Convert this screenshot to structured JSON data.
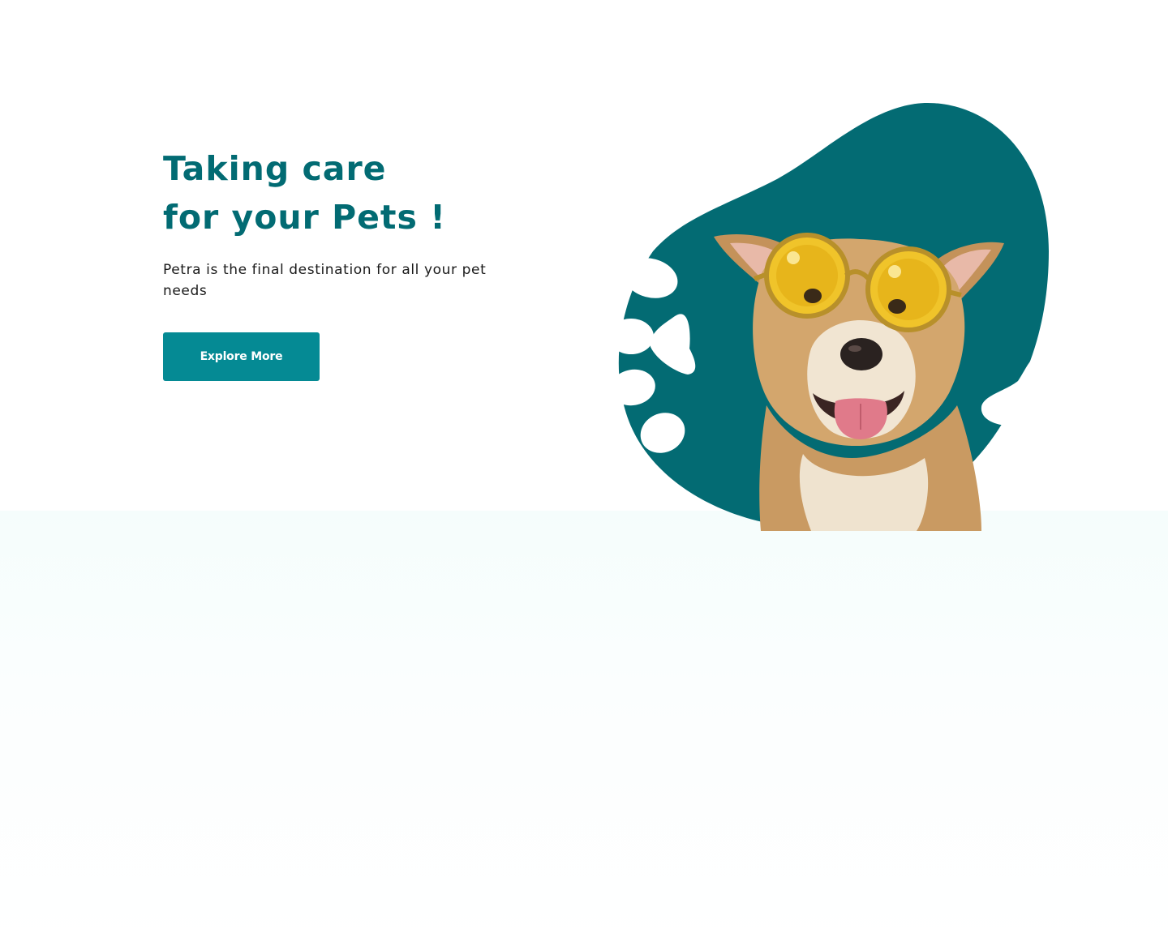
{
  "hero": {
    "title_line_1": "Taking care",
    "title_line_2": "for your Pets !",
    "subtitle": "Petra is the final destination for all your pet needs",
    "cta_label": "Explore More"
  },
  "image": {
    "subject": "dog wearing yellow round sunglasses"
  },
  "colors": {
    "brand_dark_teal": "#026b73",
    "button_teal": "#058a94",
    "blob_teal": "#036b73",
    "lower_band": "#f5fdfc"
  }
}
